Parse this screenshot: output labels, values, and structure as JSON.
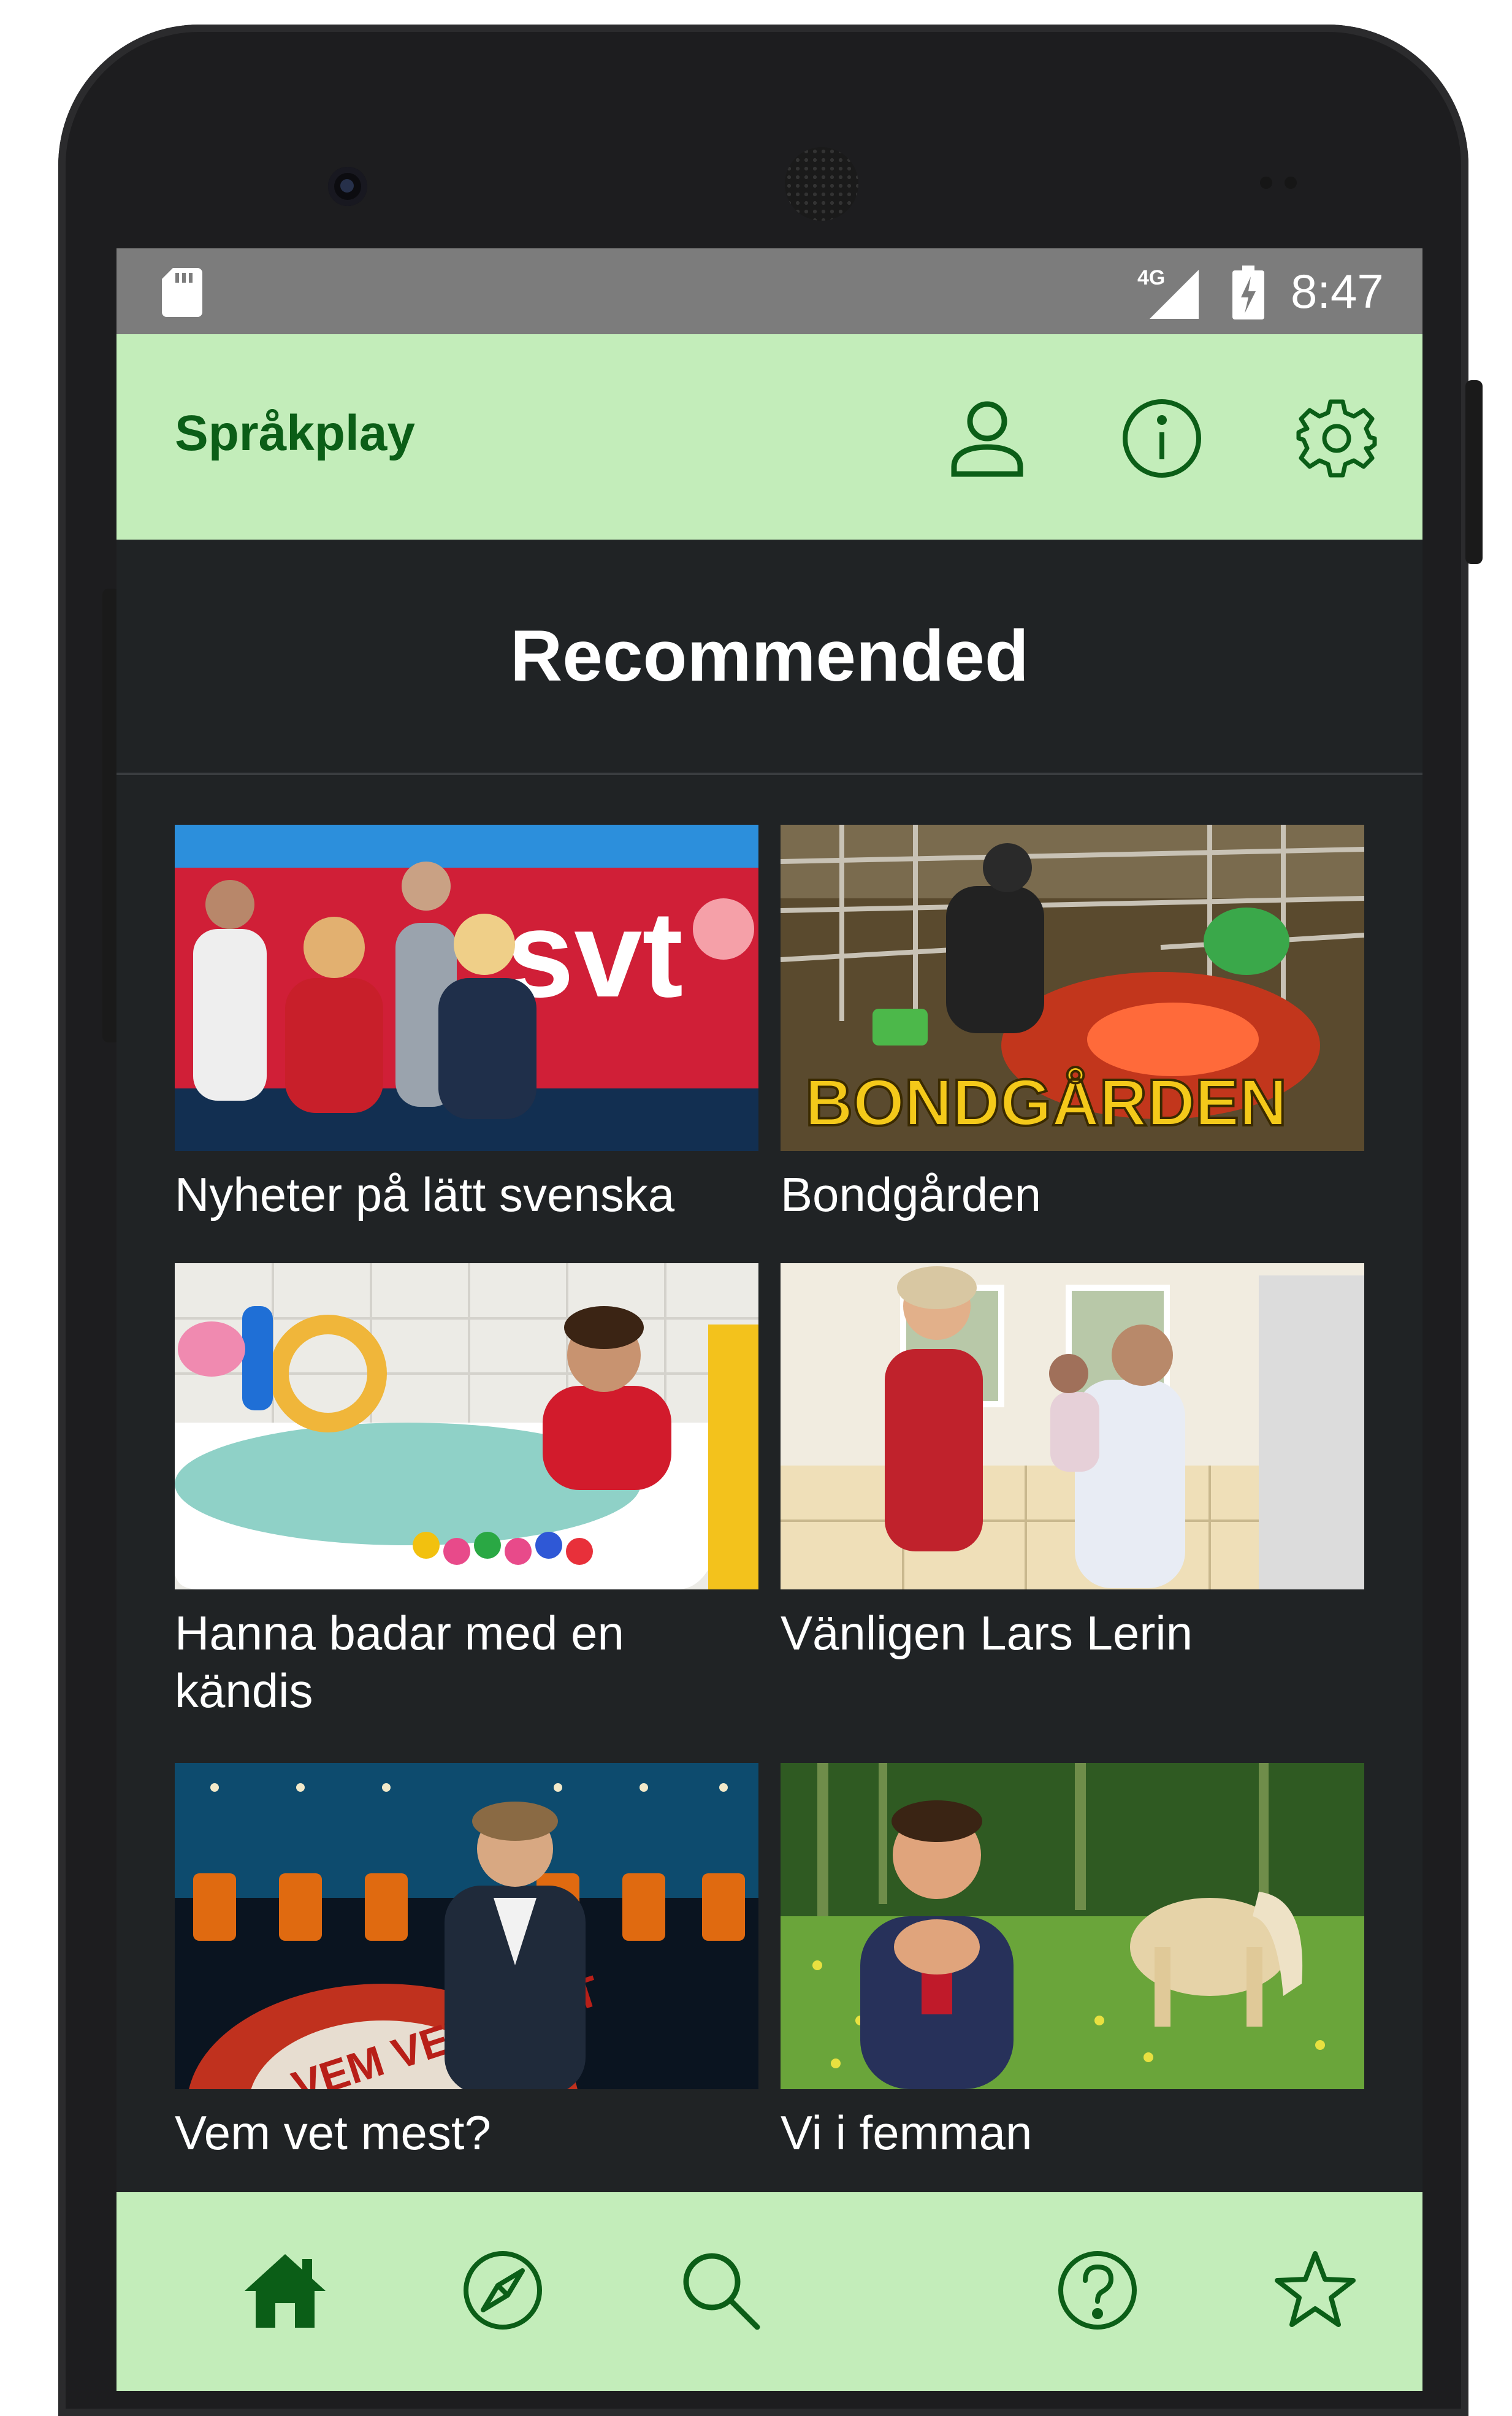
{
  "status_bar": {
    "time": "8:47",
    "network_label": "4G",
    "icons": [
      "sd-card-icon",
      "signal-icon",
      "battery-charging-icon"
    ]
  },
  "app_bar": {
    "title": "Språkplay",
    "actions": [
      {
        "name": "profile",
        "icon": "person-icon"
      },
      {
        "name": "info",
        "icon": "info-icon"
      },
      {
        "name": "settings",
        "icon": "gear-icon"
      }
    ]
  },
  "section": {
    "title": "Recommended"
  },
  "programs": [
    {
      "title": "Nyheter på lätt svenska",
      "thumb_text": "svt"
    },
    {
      "title": "Bondgården",
      "thumb_text": "BONDGÅRDEN"
    },
    {
      "title": "Hanna badar med en kändis",
      "thumb_text": ""
    },
    {
      "title": "Vänligen Lars Lerin",
      "thumb_text": ""
    },
    {
      "title": "Vem vet mest?",
      "thumb_text": "VEM VET MEST"
    },
    {
      "title": "Vi i femman",
      "thumb_text": ""
    }
  ],
  "bottom_nav": {
    "items": [
      {
        "name": "home",
        "icon": "home-icon",
        "selected": true
      },
      {
        "name": "explore",
        "icon": "compass-icon"
      },
      {
        "name": "search",
        "icon": "search-icon"
      },
      {
        "name": "help",
        "icon": "help-icon"
      },
      {
        "name": "favorites",
        "icon": "star-icon"
      }
    ]
  },
  "colors": {
    "accent_bar": "#c3edba",
    "accent_text": "#0b5e17",
    "screen_bg": "#202325",
    "status_bar": "#7c7c7c"
  }
}
